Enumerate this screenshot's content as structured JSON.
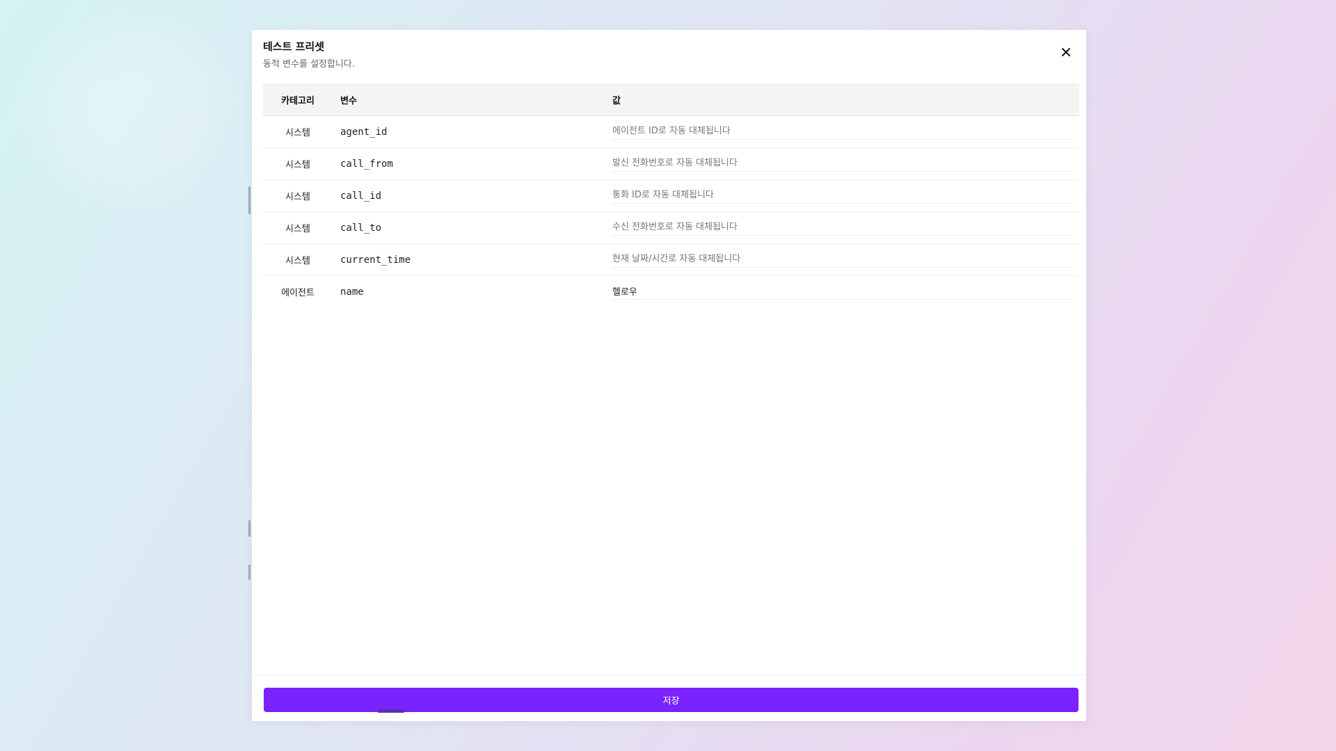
{
  "modal": {
    "title": "테스트 프리셋",
    "subtitle": "동적 변수를 설정합니다.",
    "close_icon": "close-icon"
  },
  "table": {
    "headers": {
      "category": "카테고리",
      "variable": "변수",
      "value": "값"
    },
    "rows": [
      {
        "category": "시스템",
        "variable": "agent_id",
        "value": "",
        "placeholder": "에이전트 ID로 자동 대체됩니다"
      },
      {
        "category": "시스템",
        "variable": "call_from",
        "value": "",
        "placeholder": "발신 전화번호로 자동 대체됩니다"
      },
      {
        "category": "시스템",
        "variable": "call_id",
        "value": "",
        "placeholder": "통화 ID로 자동 대체됩니다"
      },
      {
        "category": "시스템",
        "variable": "call_to",
        "value": "",
        "placeholder": "수신 전화번호로 자동 대체됩니다"
      },
      {
        "category": "시스템",
        "variable": "current_time",
        "value": "",
        "placeholder": "현재 날짜/시간로 자동 대체됩니다"
      },
      {
        "category": "에이전트",
        "variable": "name",
        "value": "헬로우",
        "placeholder": ""
      }
    ]
  },
  "footer": {
    "save_label": "저장"
  },
  "colors": {
    "accent": "#7a22ff",
    "header_bg": "#f4f4f5"
  }
}
